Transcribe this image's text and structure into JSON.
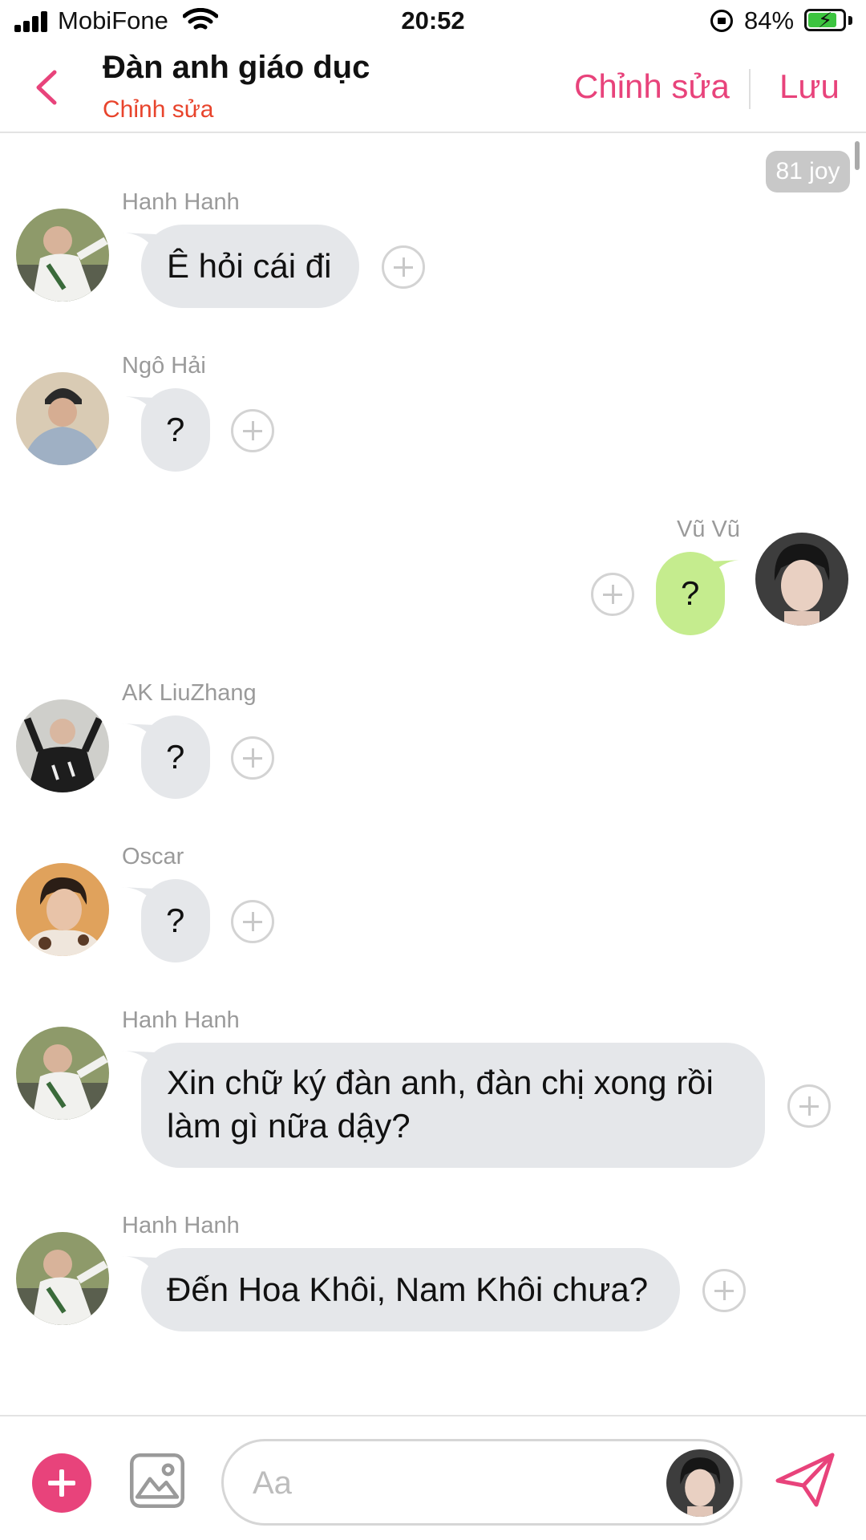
{
  "status_bar": {
    "carrier": "MobiFone",
    "time": "20:52",
    "battery_percent": "84%",
    "battery_level": 0.84,
    "icons": [
      "signal-icon",
      "wifi-icon",
      "rotation-lock-icon",
      "battery-charging-icon"
    ]
  },
  "header": {
    "title": "Đàn anh giáo dục",
    "subtitle": "Chỉnh sửa",
    "edit_label": "Chỉnh sửa",
    "save_label": "Lưu",
    "accent_color": "#e8437b",
    "subtitle_color": "#e8442c"
  },
  "chat": {
    "joy_badge": "81 joy",
    "messages": [
      {
        "sender": "Hanh Hanh",
        "text": "Ê hỏi cái đi",
        "side": "left",
        "avatar": "hanh-hanh"
      },
      {
        "sender": "Ngô Hải",
        "text": "?",
        "side": "left",
        "avatar": "ngo-hai"
      },
      {
        "sender": "Vũ Vũ",
        "text": "?",
        "side": "right",
        "avatar": "vu-vu"
      },
      {
        "sender": "AK LiuZhang",
        "text": "?",
        "side": "left",
        "avatar": "ak-liuzhang"
      },
      {
        "sender": "Oscar",
        "text": "?",
        "side": "left",
        "avatar": "oscar"
      },
      {
        "sender": "Hanh Hanh",
        "text_line1": "Xin chữ ký đàn anh, đàn chị xong rồi",
        "text_line2": "làm gì nữa dậy?",
        "side": "left",
        "avatar": "hanh-hanh"
      },
      {
        "sender": "Hanh Hanh",
        "text": "Đến Hoa Khôi, Nam Khôi chưa?",
        "side": "left",
        "avatar": "hanh-hanh"
      }
    ],
    "bubble_color_other": "#e5e7ea",
    "bubble_color_me": "#c5ec8e"
  },
  "composer": {
    "placeholder": "Aa",
    "icons": [
      "add-icon",
      "image-icon",
      "send-icon"
    ]
  }
}
